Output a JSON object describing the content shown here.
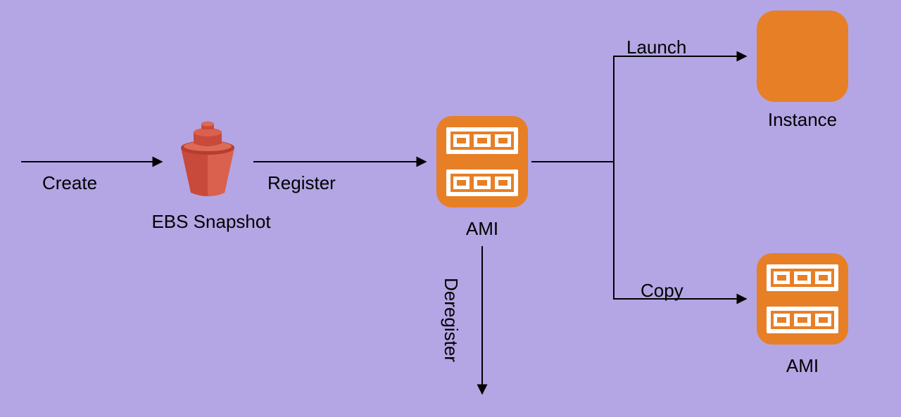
{
  "edges": {
    "create": "Create",
    "register": "Register",
    "launch": "Launch",
    "copy": "Copy",
    "deregister": "Deregister"
  },
  "nodes": {
    "ebs_snapshot": "EBS Snapshot",
    "ami": "AMI",
    "instance": "Instance",
    "ami2": "AMI"
  }
}
